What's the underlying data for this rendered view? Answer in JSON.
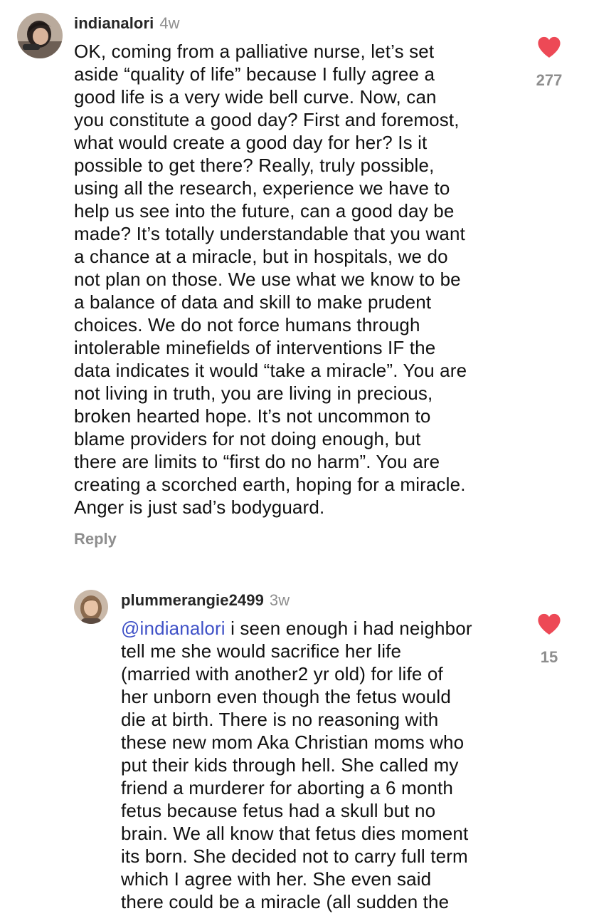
{
  "comments": [
    {
      "username": "indianalori",
      "time": "4w",
      "text": "OK, coming from a palliative nurse, let’s set\naside “quality of life” because I fully agree a\ngood life is a very wide bell curve. Now, can\nyou constitute a good day? First and foremost,\nwhat would create a good day for her? Is it\npossible to get there? Really, truly possible,\nusing all the research, experience we have to\nhelp us see into the future, can a good day be\nmade? It’s totally understandable that you want\na chance at a miracle, but in hospitals, we do\nnot plan on those. We use what we know to be\na balance of data and skill to make prudent\nchoices. We do not force humans through\nintolerable minefields of interventions IF the\ndata indicates it would “take a miracle”. You are\nnot living in truth, you are living in precious,\nbroken hearted hope. It’s not uncommon to\nblame providers for not doing enough, but\nthere are limits to “first do no harm”. You are\ncreating a scorched earth, hoping for a miracle.\nAnger is just sad’s bodyguard.",
      "likes": "277",
      "reply_label": "Reply",
      "liked": true
    },
    {
      "username": "plummerangie2499",
      "time": "3w",
      "mention": "@indianalori",
      "text": " i seen enough i had neighbor\ntell me she would sacrifice her life\n(married with another2 yr old) for life of\nher unborn even though the fetus would\ndie at birth. There is no reasoning with\nthese new mom Aka Christian moms who\nput their kids through hell. She called my\nfriend a murderer for aborting a 6 month\nfetus because fetus had a skull but no\nbrain. We all know that fetus dies moment\nits born. She decided not to carry full term\nwhich I agree with her. She even said\nthere could be a miracle (all sudden the",
      "likes": "15",
      "liked": true
    }
  ],
  "colors": {
    "heart": "#ed4956",
    "mention": "#3f51c7",
    "muted": "#8e8e8e"
  },
  "icons": {
    "like": "heart-icon"
  }
}
